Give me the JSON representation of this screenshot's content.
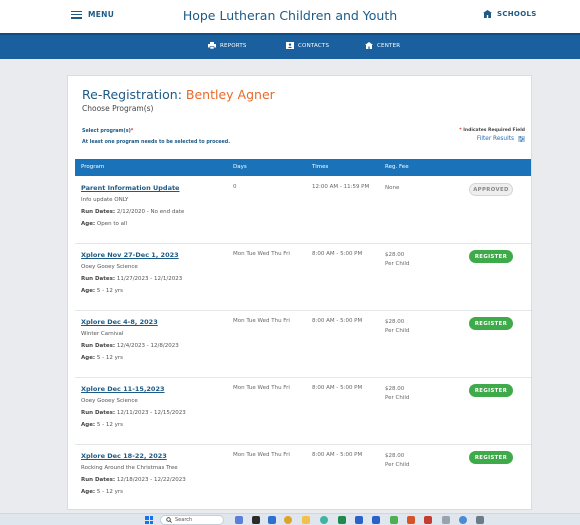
{
  "header": {
    "menu_label": "MENU",
    "site_title": "Hope Lutheran Children and Youth",
    "schools_label": "SCHOOLS"
  },
  "nav": {
    "reports": "REPORTS",
    "contacts": "CONTACTS",
    "center": "CENTER"
  },
  "page": {
    "title_prefix": "Re-Registration:",
    "student_name": "Bentley Agner",
    "subtitle": "Choose Program(s)",
    "select_label": "Select program(s)",
    "required_star": "*",
    "warning": "At least one program needs to be selected to proceed.",
    "required_note_star": "*",
    "required_note": "Indicates Required Field",
    "filter_label": "Filter Results"
  },
  "table": {
    "headers": [
      "Program",
      "Days",
      "Times",
      "Reg. Fee"
    ],
    "run_dates_label": "Run Dates:",
    "age_label": "Age:",
    "rows": [
      {
        "name": "Parent Information Update",
        "desc": "Info update ONLY",
        "run_dates": "2/12/2020 - No end date",
        "age": "Open to all",
        "days": "0",
        "times": "12:00 AM - 11:59 PM",
        "fee": "None",
        "fee2": "",
        "action": "APPROVED"
      },
      {
        "name": "Xplore Nov 27-Dec 1, 2023",
        "desc": "Ooey Gooey Science",
        "run_dates": "11/27/2023 - 12/1/2023",
        "age": "5 - 12 yrs",
        "days": "Mon Tue Wed Thu Fri",
        "times": "8:00 AM - 5:00 PM",
        "fee": "$28.00",
        "fee2": "Per Child",
        "action": "REGISTER"
      },
      {
        "name": "Xplore Dec 4-8, 2023",
        "desc": "Winter Carnival",
        "run_dates": "12/4/2023 - 12/8/2023",
        "age": "5 - 12 yrs",
        "days": "Mon Tue Wed Thu Fri",
        "times": "8:00 AM - 5:00 PM",
        "fee": "$28.00",
        "fee2": "Per Child",
        "action": "REGISTER"
      },
      {
        "name": "Xplore Dec 11-15,2023",
        "desc": "Ooey Gooey Science",
        "run_dates": "12/11/2023 - 12/15/2023",
        "age": "5 - 12 yrs",
        "days": "Mon Tue Wed Thu Fri",
        "times": "8:00 AM - 5:00 PM",
        "fee": "$28.00",
        "fee2": "Per Child",
        "action": "REGISTER"
      },
      {
        "name": "Xplore Dec 18-22, 2023",
        "desc": "Rocking Around the Christmas Tree",
        "run_dates": "12/18/2023 - 12/22/2023",
        "age": "5 - 12 yrs",
        "days": "Mon Tue Wed Thu Fri",
        "times": "8:00 AM - 5:00 PM",
        "fee": "$28.00",
        "fee2": "Per Child",
        "action": "REGISTER"
      }
    ]
  },
  "taskbar": {
    "search_label": "Search"
  },
  "colors": {
    "brand_blue": "#1a5f9e",
    "name_orange": "#e86a2b",
    "register_green": "#3faa4a"
  }
}
